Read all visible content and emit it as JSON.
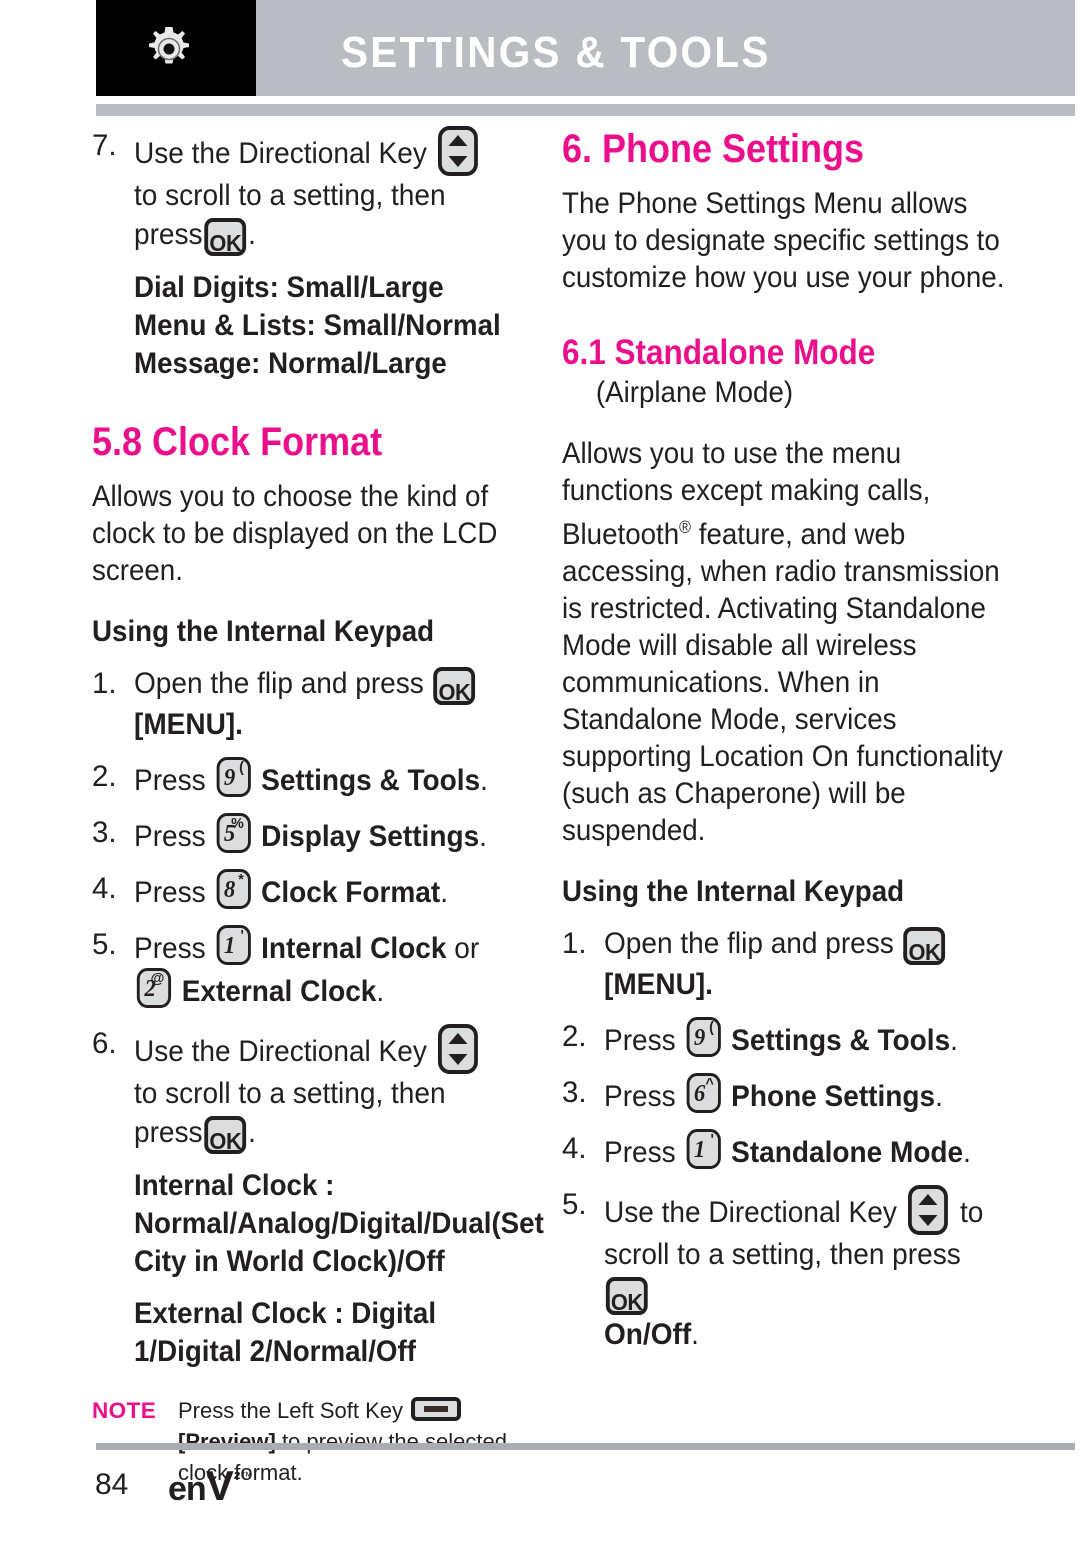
{
  "header": {
    "title": "SETTINGS & TOOLS",
    "icon": "gear-icon"
  },
  "left_column": {
    "step7": {
      "num": "7.",
      "text_before_dirkey": "Use the Directional Key",
      "text_after_dirkey": "to scroll to a setting, then press",
      "text_end": "."
    },
    "options_block_1": [
      "Dial Digits: Small/Large",
      "Menu & Lists: Small/Normal",
      "Message: Normal/Large"
    ],
    "heading_58": "5.8 Clock Format",
    "intro_58": "Allows you to choose the kind of clock to be displayed on the LCD screen.",
    "subheading_keypad": "Using the Internal Keypad",
    "steps": [
      {
        "num": "1.",
        "text": "Open the flip and press",
        "key": "OK",
        "after": "[MENU].",
        "after_bold": true
      },
      {
        "num": "2.",
        "text": "Press",
        "key_digit": "9",
        "key_sup": "(",
        "label": "Settings & Tools",
        "period": "."
      },
      {
        "num": "3.",
        "text": "Press",
        "key_digit": "5",
        "key_sup": "%",
        "label": "Display Settings",
        "period": "."
      },
      {
        "num": "4.",
        "text": "Press",
        "key_digit": "8",
        "key_sup": "*",
        "label": "Clock Format",
        "period": "."
      },
      {
        "num": "5.",
        "text": "Press",
        "key_digit": "1",
        "key_sup": "'",
        "label": "Internal Clock",
        "conj": "or",
        "key_digit2": "2",
        "key_sup2": "@",
        "label2": "External Clock",
        "period": "."
      }
    ],
    "step6": {
      "num": "6.",
      "text_before_dirkey": "Use the Directional Key",
      "text_after_dirkey": "to scroll to a setting, then press",
      "text_end": "."
    },
    "options_block_2": [
      "Internal Clock : Normal/Analog/Digital/Dual(Set City in World Clock)/Off",
      "External Clock : Digital 1/Digital 2/Normal/Off"
    ],
    "note": {
      "label": "NOTE",
      "text_before_key": "Press the Left Soft Key",
      "bold_part": "[Preview]",
      "text_after": " to preview the selected clock format."
    }
  },
  "right_column": {
    "heading_6": "6. Phone Settings",
    "intro_6": "The Phone Settings Menu allows you to designate specific settings to customize how you use your phone.",
    "heading_61": "6.1 Standalone Mode",
    "subtitle_61": "(Airplane Mode)",
    "body_part1": "Allows you to use the menu functions except making calls, Bluetooth",
    "body_reg": "®",
    "body_part2": " feature, and web accessing, when radio transmission is restricted. Activating Standalone Mode will disable all wireless communications. When in Standalone Mode, services supporting Location On functionality (such as Chaperone) will be suspended.",
    "subheading_keypad": "Using the Internal Keypad",
    "steps": [
      {
        "num": "1.",
        "text": "Open the flip and press",
        "key": "OK",
        "after": "[MENU].",
        "after_bold": true
      },
      {
        "num": "2.",
        "text": "Press",
        "key_digit": "9",
        "key_sup": "(",
        "label": "Settings & Tools",
        "period": "."
      },
      {
        "num": "3.",
        "text": "Press",
        "key_digit": "6",
        "key_sup": "^",
        "label": "Phone Settings",
        "period": "."
      },
      {
        "num": "4.",
        "text": "Press",
        "key_digit": "1",
        "key_sup": "'",
        "label": "Standalone Mode",
        "period": "."
      }
    ],
    "step5": {
      "num": "5.",
      "text_before_dirkey": "Use the Directional Key",
      "text_after_dirkey": "to scroll to a setting, then press",
      "bold_tail": "On/Off",
      "period": "."
    }
  },
  "footer": {
    "page_number": "84",
    "logo_en": "en",
    "logo_v": "V",
    "logo_2": "²",
    "logo_tm": "™"
  },
  "colors": {
    "accent_pink": "#ec0f8c",
    "header_gray": "#b9bcc0",
    "text": "#231f20",
    "key_fill": "#dcdddf"
  }
}
